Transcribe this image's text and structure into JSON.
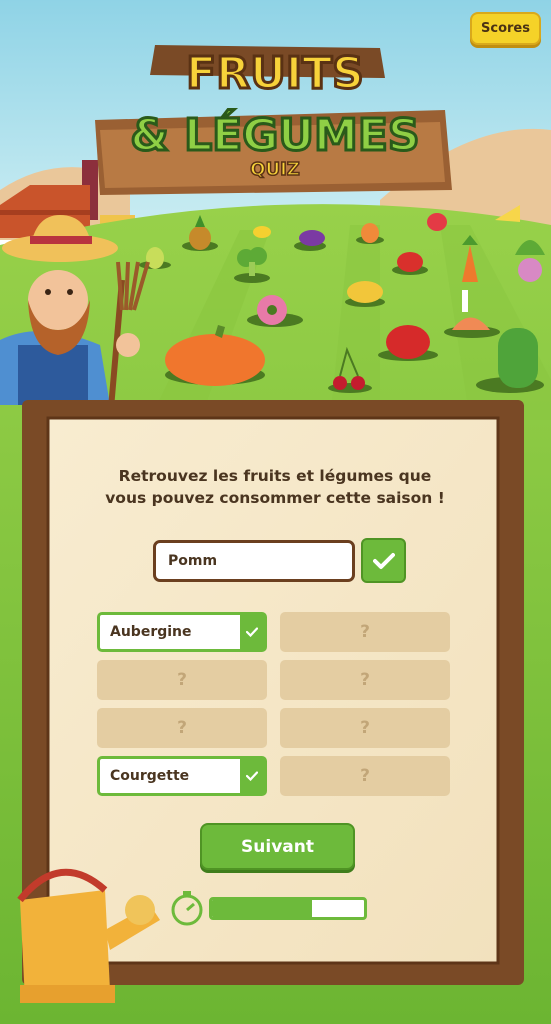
{
  "title": {
    "line1": "FRUITS",
    "line2": "& LÉGUMES",
    "line3": "QUIZ"
  },
  "scores_button": "Scores",
  "question": {
    "line1": "Retrouvez les fruits et légumes que",
    "line2": "vous pouvez consommer cette saison !"
  },
  "answer_input": {
    "value": "Pomm"
  },
  "slots": [
    {
      "label": "Aubergine",
      "found": true
    },
    {
      "label": "?",
      "found": false
    },
    {
      "label": "?",
      "found": false
    },
    {
      "label": "Courgette",
      "found": true
    },
    {
      "label": "?",
      "found": false
    },
    {
      "label": "?",
      "found": false
    },
    {
      "label": "?",
      "found": false
    },
    {
      "label": "?",
      "found": false
    }
  ],
  "next_button": "Suivant",
  "timer": {
    "remaining_fraction": 0.66
  },
  "colors": {
    "accent_green": "#6dba3b",
    "wood": "#7a4a26",
    "board": "#f6e9c9"
  }
}
